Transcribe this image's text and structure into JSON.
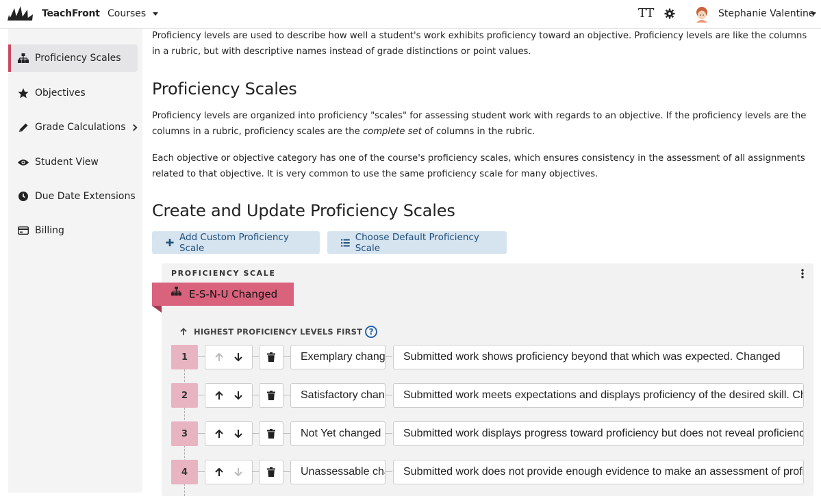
{
  "header": {
    "brand": "TeachFront",
    "courses_label": "Courses",
    "text_size_glyph": "TT",
    "user_name": "Stephanie Valentine"
  },
  "sidebar": {
    "items": [
      {
        "label": "Proficiency Scales",
        "icon": "sitemap-icon",
        "active": true
      },
      {
        "label": "Objectives",
        "icon": "star-icon"
      },
      {
        "label": "Grade Calculations",
        "icon": "pencil-icon",
        "has_submenu": true
      },
      {
        "label": "Student View",
        "icon": "eye-icon"
      },
      {
        "label": "Due Date Extensions",
        "icon": "clock-icon"
      },
      {
        "label": "Billing",
        "icon": "credit-card-icon"
      }
    ]
  },
  "main": {
    "intro": "Proficiency levels are used to describe how well a student's work exhibits proficiency toward an objective. Proficiency levels are like the columns in a rubric, but with descriptive names instead of grade distinctions or point values.",
    "h_scales": "Proficiency Scales",
    "p_scales_1a": "Proficiency levels are organized into proficiency \"scales\" for assessing student work with regards to an objective. If the proficiency levels are the columns in a rubric, proficiency scales are the ",
    "p_scales_1_em": "complete set",
    "p_scales_1b": " of columns in the rubric.",
    "p_scales_2": "Each objective or objective category has one of the course's proficiency scales, which ensures consistency in the assessment of all assignments related to that objective. It is very common to use the same proficiency scale for many objectives.",
    "h_create": "Create and Update Proficiency Scales",
    "add_button": "Add Custom Proficiency Scale",
    "choose_button": "Choose Default Proficiency Scale"
  },
  "scale": {
    "label": "PROFICIENCY SCALE",
    "name": "E-S-N-U Changed",
    "order_label": "HIGHEST PROFICIENCY LEVELS FIRST",
    "help_glyph": "?",
    "levels": [
      {
        "num": "1",
        "name": "Exemplary changed",
        "desc": "Submitted work shows proficiency beyond that which was expected. Changed",
        "up_enabled": false,
        "down_enabled": true
      },
      {
        "num": "2",
        "name": "Satisfactory changed",
        "desc": "Submitted work meets expectations and displays proficiency of the desired skill. Changed",
        "up_enabled": true,
        "down_enabled": true
      },
      {
        "num": "3",
        "name": "Not Yet changed",
        "desc": "Submitted work displays progress toward proficiency but does not reveal proficiency. Changed",
        "up_enabled": true,
        "down_enabled": true
      },
      {
        "num": "4",
        "name": "Unassessable changed",
        "desc": "Submitted work does not provide enough evidence to make an assessment of proficiency. Changed",
        "up_enabled": true,
        "down_enabled": false
      }
    ]
  },
  "colors": {
    "accent": "#c94a66",
    "scale_tab": "#d9627c",
    "level_num_bg": "#e8b4c1",
    "button_bg": "#d6e4f0",
    "button_text": "#1f4e7a"
  }
}
